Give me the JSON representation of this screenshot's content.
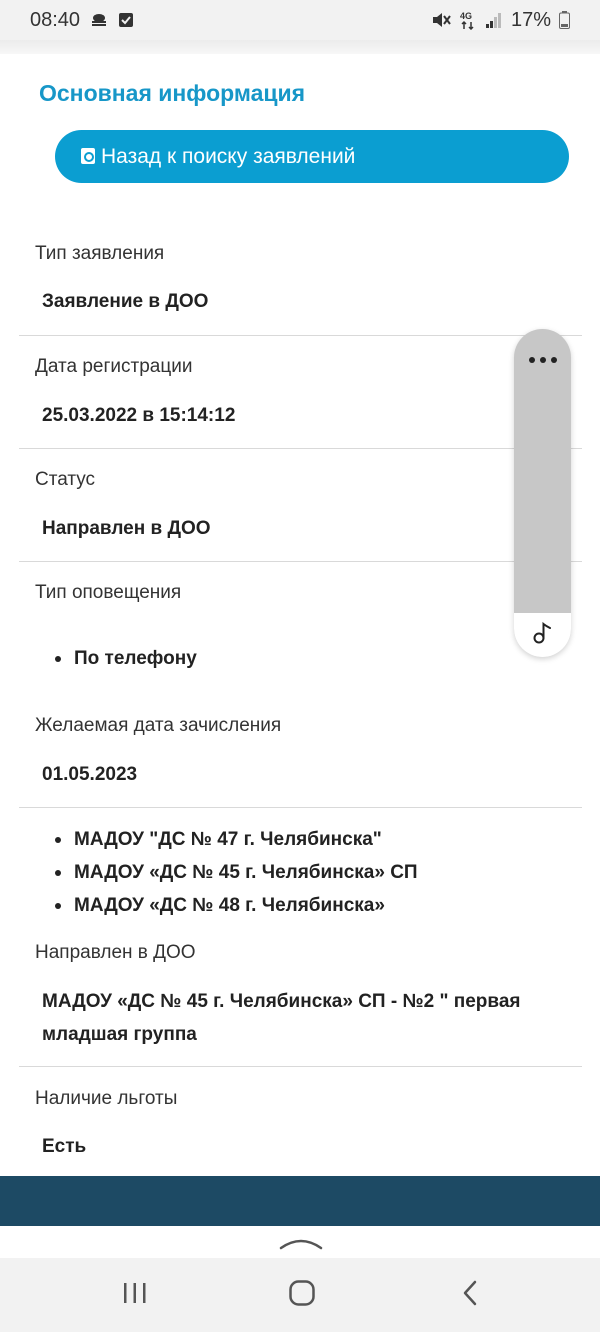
{
  "status_bar": {
    "time": "08:40",
    "battery": "17%"
  },
  "section_title": "Основная информация",
  "back_button": {
    "label": "Назад к поиску заявлений"
  },
  "fields": {
    "application_type": {
      "label": "Тип заявления",
      "value": "Заявление в ДОО"
    },
    "registration_date": {
      "label": "Дата регистрации",
      "value": "25.03.2022 в 15:14:12"
    },
    "status": {
      "label": "Статус",
      "value": "Направлен в ДОО"
    },
    "notification_type": {
      "label": "Тип оповещения",
      "items": [
        "По телефону"
      ]
    },
    "desired_date": {
      "label": "Желаемая дата зачисления",
      "value": "01.05.2023"
    },
    "preferred_doo": {
      "items": [
        "МАДОУ \"ДС № 47 г. Челябинска\"",
        "МАДОУ «ДС № 45 г. Челябинска» СП",
        "МАДОУ «ДС № 48 г. Челябинска»"
      ]
    },
    "directed_to": {
      "label": "Направлен в ДОО",
      "value": "МАДОУ «ДС № 45 г. Челябинска» СП - №2 \" первая младшая группа"
    },
    "benefits": {
      "label": "Наличие льготы",
      "value": "Есть"
    }
  },
  "floating_panel": {
    "top_icon": "more-dots-icon",
    "bottom_icon": "music-note-icon"
  },
  "navigation": {
    "icons": [
      "recent-apps-icon",
      "home-icon",
      "back-icon"
    ]
  },
  "colors": {
    "accent": "#0b9ed1",
    "title": "#1797c8",
    "footer": "#1d4a64"
  }
}
